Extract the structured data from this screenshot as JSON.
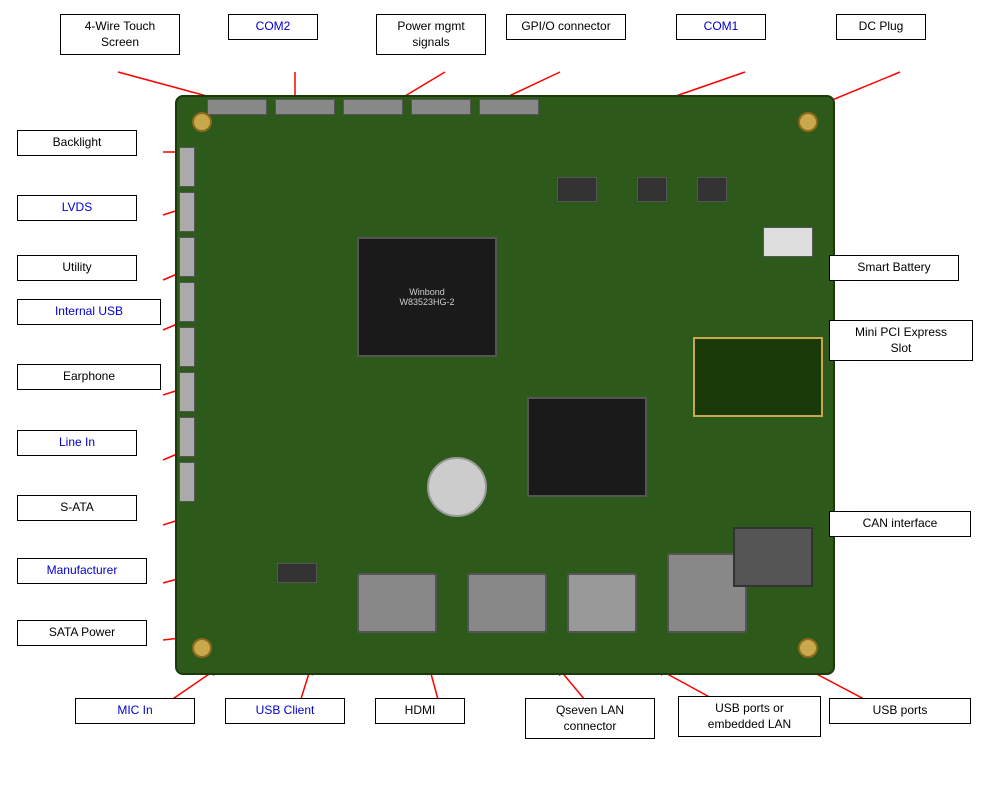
{
  "labels": {
    "top_row": [
      {
        "id": "4wire-touch",
        "text": "4-Wire Touch\nScreen",
        "blue": false
      },
      {
        "id": "com2",
        "text": "COM2",
        "blue": true
      },
      {
        "id": "power-mgmt",
        "text": "Power mgmt\nsignals",
        "blue": false
      },
      {
        "id": "gpio-connector",
        "text": "GPI/O connector",
        "blue": false
      },
      {
        "id": "com1",
        "text": "COM1",
        "blue": true
      },
      {
        "id": "dc-plug",
        "text": "DC Plug",
        "blue": false
      }
    ],
    "left_col": [
      {
        "id": "backlight",
        "text": "Backlight",
        "blue": false
      },
      {
        "id": "lvds",
        "text": "LVDS",
        "blue": true
      },
      {
        "id": "utility",
        "text": "Utility",
        "blue": false
      },
      {
        "id": "internal-usb",
        "text": "Internal USB",
        "blue": true
      },
      {
        "id": "earphone",
        "text": "Earphone",
        "blue": false
      },
      {
        "id": "line-in",
        "text": "Line In",
        "blue": true
      },
      {
        "id": "s-ata",
        "text": "S-ATA",
        "blue": false
      },
      {
        "id": "manufacturer",
        "text": "Manufacturer",
        "blue": true
      },
      {
        "id": "sata-power",
        "text": "SATA Power",
        "blue": false
      }
    ],
    "right_col": [
      {
        "id": "smart-battery",
        "text": "Smart Battery",
        "blue": false
      },
      {
        "id": "mini-pci",
        "text": "Mini PCI Express\nSlot",
        "blue": false
      },
      {
        "id": "can-interface",
        "text": "CAN interface",
        "blue": false
      }
    ],
    "bottom_row": [
      {
        "id": "mic-in",
        "text": "MIC In",
        "blue": true
      },
      {
        "id": "usb-client",
        "text": "USB Client",
        "blue": true
      },
      {
        "id": "hdmi",
        "text": "HDMI",
        "blue": false
      },
      {
        "id": "qseven-lan",
        "text": "Qseven LAN\nconnector",
        "blue": false
      },
      {
        "id": "usb-embedded-lan",
        "text": "USB ports or\nembedded LAN",
        "blue": false
      },
      {
        "id": "usb-ports",
        "text": "USB ports",
        "blue": false
      }
    ]
  },
  "board_label": "Winbond\nW83523HG-2",
  "colors": {
    "arrow": "red",
    "label_border": "#000000",
    "board_green": "#2d5a1b",
    "blue_text": "#0000cc"
  }
}
